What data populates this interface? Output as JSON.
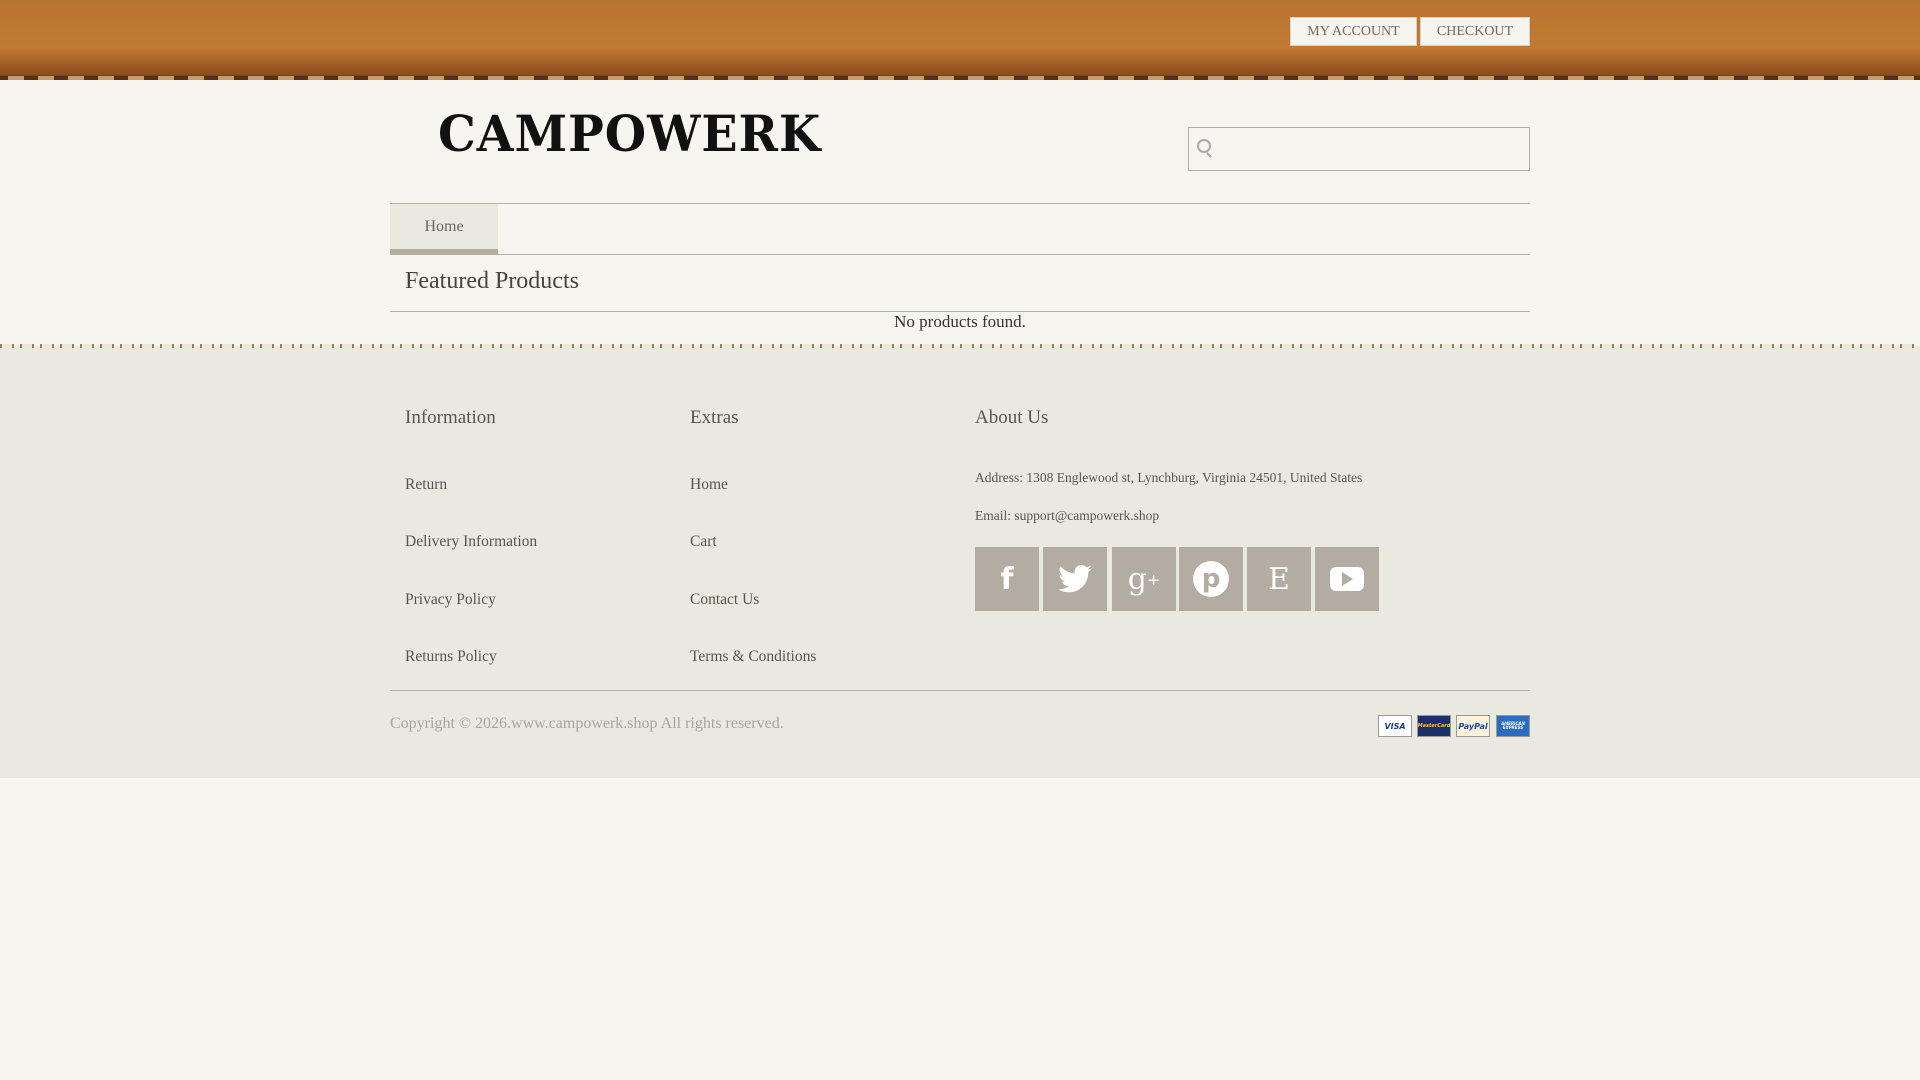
{
  "header": {
    "my_account": "MY ACCOUNT",
    "checkout": "CHECKOUT"
  },
  "logo": "CAMPOWERK",
  "search": {
    "placeholder": ""
  },
  "nav": {
    "home": "Home"
  },
  "main": {
    "title": "Featured Products",
    "empty": "No products found."
  },
  "footer": {
    "information": {
      "title": "Information",
      "links": [
        "Return",
        "Delivery Information",
        "Privacy Policy",
        "Returns Policy"
      ]
    },
    "extras": {
      "title": "Extras",
      "links": [
        "Home",
        "Cart",
        "Contact Us",
        "Terms & Conditions"
      ]
    },
    "about": {
      "title": "About Us",
      "address": "Address: 1308 Englewood st, Lynchburg, Virginia 24501, United States",
      "email": "Email: support@campowerk.shop"
    },
    "social": [
      "facebook-icon",
      "twitter-icon",
      "google-plus-icon",
      "pinterest-icon",
      "etsy-icon",
      "youtube-icon"
    ],
    "copyright": "Copyright © 2026.www.campowerk.shop All rights reserved.",
    "payments": [
      "VISA",
      "MasterCard",
      "PayPal",
      "AMERICAN EXPRESS"
    ]
  }
}
